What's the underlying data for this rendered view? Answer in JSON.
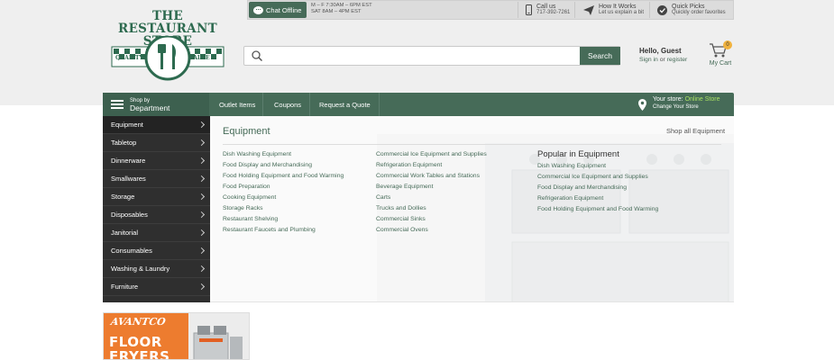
{
  "logo": {
    "line1": "THE RESTAURANT",
    "line2": "STORE",
    "badge_left": "QUALITY",
    "badge_right": "VALUE"
  },
  "top_strip": {
    "chat_label": "Chat Offline",
    "hours_line1": "M – F 7:30AM – 6PM EST",
    "hours_line2": "SAT 8AM – 4PM EST",
    "call_title": "Call us",
    "call_number": "717-392-7261",
    "how_title": "How It Works",
    "how_sub": "Let us explain a bit",
    "picks_title": "Quick Picks",
    "picks_sub": "Quickly order favorites"
  },
  "search": {
    "placeholder": "",
    "button_label": "Search"
  },
  "account": {
    "hello": "Hello, Guest",
    "sign_in": "Sign in",
    "or": "or",
    "register": "register"
  },
  "cart": {
    "count": "0",
    "label": "My Cart"
  },
  "nav": {
    "dept_small": "Shop by",
    "dept_big": "Department",
    "links": [
      "Outlet Items",
      "Coupons",
      "Request a Quote"
    ],
    "store_prefix": "Your store:",
    "store_name": "Online Store",
    "store_change": "Change Your Store"
  },
  "sidebar": {
    "items": [
      "Equipment",
      "Tabletop",
      "Dinnerware",
      "Smallwares",
      "Storage",
      "Disposables",
      "Janitorial",
      "Consumables",
      "Washing & Laundry",
      "Furniture"
    ]
  },
  "panel": {
    "title": "Equipment",
    "shop_all": "Shop all Equipment",
    "col1": [
      "Dish Washing Equipment",
      "Food Display and Merchandising",
      "Food Holding Equipment and Food Warming",
      "Food Preparation",
      "Cooking Equipment",
      "Storage Racks",
      "Restaurant Shelving",
      "Restaurant Faucets and Plumbing"
    ],
    "col2": [
      "Commercial Ice Equipment and Supplies",
      "Refrigeration Equipment",
      "Commercial Work Tables and Stations",
      "Beverage Equipment",
      "Carts",
      "Trucks and Dollies",
      "Commercial Sinks",
      "Commercial Ovens"
    ],
    "popular_title": "Popular in Equipment",
    "popular": [
      "Dish Washing Equipment",
      "Commercial Ice Equipment and Supplies",
      "Food Display and Merchandising",
      "Refrigeration Equipment",
      "Food Holding Equipment and Food Warming"
    ]
  },
  "ad": {
    "brand": "AVANTCO",
    "line1": "FLOOR",
    "line2": "FRYERS"
  },
  "colors": {
    "brand_green": "#466b58",
    "sidebar_dark": "#2f2f2f",
    "accent_orange": "#ed7c2f",
    "store_highlight": "#a8e063"
  }
}
